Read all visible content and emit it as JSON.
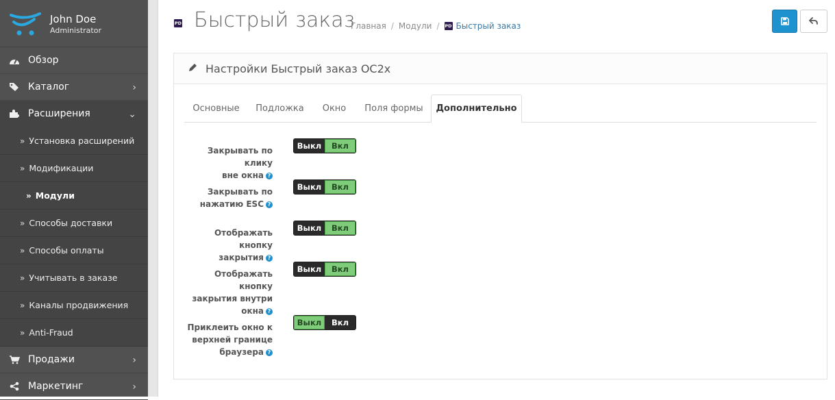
{
  "user": {
    "name": "John Doe",
    "role": "Administrator"
  },
  "nav": {
    "top": [
      {
        "label": "Обзор",
        "icon": "dashboard-icon"
      },
      {
        "label": "Каталог",
        "icon": "tags-icon"
      },
      {
        "label": "Расширения",
        "icon": "puzzle-icon"
      }
    ],
    "sub": [
      "Установка расширений",
      "Модификации",
      "Модули",
      "Способы доставки",
      "Способы оплаты",
      "Учитывать в заказе",
      "Каналы продвижения",
      "Anti-Fraud"
    ],
    "bottom": [
      {
        "label": "Продажи",
        "icon": "cart-icon"
      },
      {
        "label": "Маркетинг",
        "icon": "share-icon"
      }
    ]
  },
  "header": {
    "title": "Быстрый заказ",
    "breadcrumb": [
      "Главная",
      "Модули",
      "Быстрый заказ"
    ],
    "module_badge": "PD"
  },
  "panel": {
    "title": "Настройки Быстрый заказ OC2x"
  },
  "tabs": [
    "Основные",
    "Подложка",
    "Окно",
    "Поля формы",
    "Дополнительно"
  ],
  "settings": [
    {
      "label_lines": [
        "Закрывать по клику",
        "вне окна"
      ],
      "off": "Выкл",
      "on": "Вкл",
      "value": "on"
    },
    {
      "label_lines": [
        "Закрывать по",
        "нажатию ESC"
      ],
      "off": "Выкл",
      "on": "Вкл",
      "value": "on"
    },
    {
      "label_lines": [
        "Отображать кнопку",
        "закрытия"
      ],
      "off": "Выкл",
      "on": "Вкл",
      "value": "on"
    },
    {
      "label_lines": [
        "Отображать кнопку",
        "закрытия внутри",
        "окна"
      ],
      "off": "Выкл",
      "on": "Вкл",
      "value": "on"
    },
    {
      "label_lines": [
        "Приклеить окно к",
        "верхней границе",
        "браузера"
      ],
      "off": "Выкл",
      "on": "Вкл",
      "value": "off"
    }
  ],
  "colors": {
    "sidebar": "#515151",
    "primary": "#1e91cf",
    "toggle_green": "#7fcc7a",
    "toggle_dark": "#2a2a2a"
  }
}
